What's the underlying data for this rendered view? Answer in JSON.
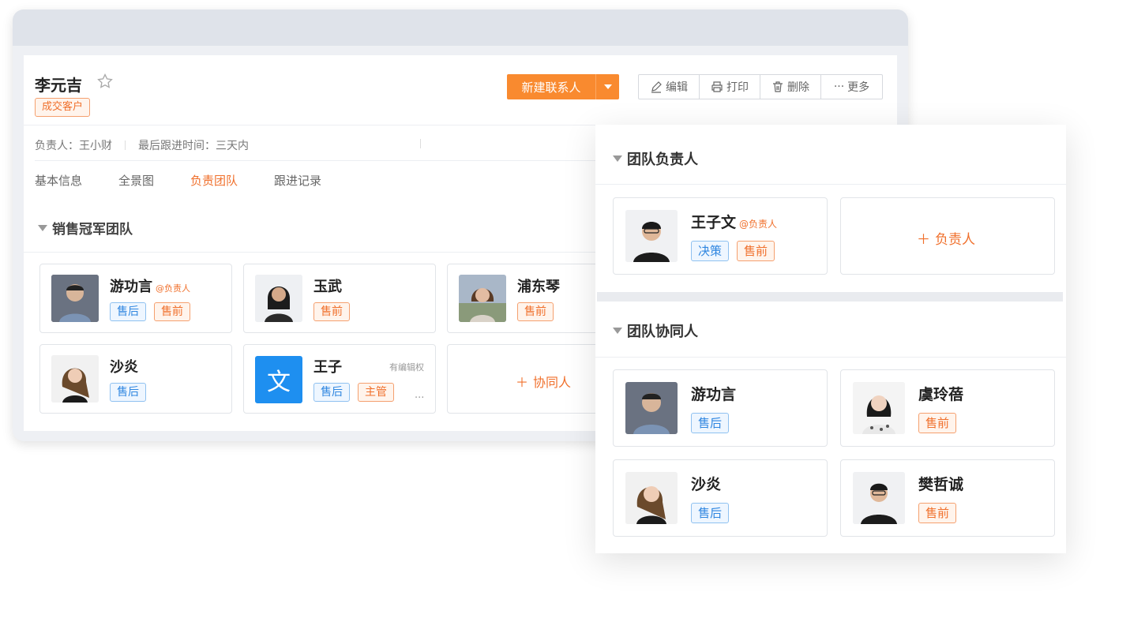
{
  "customer": {
    "name": "李元吉",
    "status_tag": "成交客户",
    "owner": "负责人：王小财",
    "last_follow": "最后跟进时间：三天内"
  },
  "toolbar": {
    "new_contact": "新建联系人",
    "edit": "编辑",
    "print": "打印",
    "delete": "删除",
    "more": "更多"
  },
  "tabs": [
    "基本信息",
    "全景图",
    "负责团队",
    "跟进记录"
  ],
  "team": {
    "title": "销售冠军团队",
    "members": [
      {
        "name": "游功言",
        "lead_tag": "@负责人",
        "tags": [
          "售后",
          "售前"
        ]
      },
      {
        "name": "玉武",
        "tags": [
          "售前"
        ]
      },
      {
        "name": "浦东琴",
        "tags": [
          "售前"
        ]
      },
      {
        "name": "沙炎",
        "tags": [
          "售后"
        ]
      },
      {
        "name": "王子",
        "avatar_text": "文",
        "perm": "有编辑权",
        "tags": [
          "售后",
          "主管"
        ],
        "more": "..."
      }
    ],
    "add_collab": "协同人"
  },
  "panel": {
    "leader_title": "团队负责人",
    "leader": {
      "name": "王子文",
      "lead_tag": "@负责人",
      "tags": [
        "决策",
        "售前"
      ]
    },
    "add_leader": "负责人",
    "collab_title": "团队协同人",
    "collaborators": [
      {
        "name": "游功言",
        "tags": [
          "售后"
        ]
      },
      {
        "name": "虞玲蓓",
        "tags": [
          "售前"
        ]
      },
      {
        "name": "沙炎",
        "tags": [
          "售后"
        ]
      },
      {
        "name": "樊哲诚",
        "tags": [
          "售前"
        ]
      }
    ]
  },
  "colors": {
    "accent": "#f98a2f",
    "blue": "#2f86e0"
  }
}
